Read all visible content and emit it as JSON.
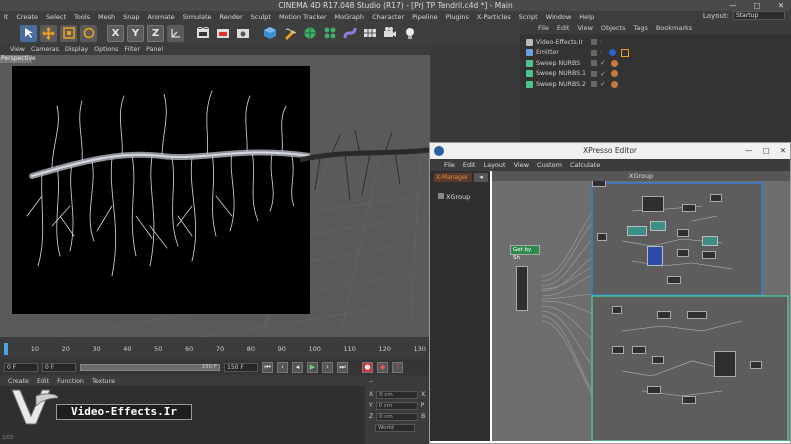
{
  "window": {
    "title": "CINEMA 4D R17.048 Studio (R17) - [Prj TP Tendril.c4d *] - Main",
    "controls": [
      "—",
      "□",
      "✕"
    ]
  },
  "menubar": {
    "items": [
      "lt",
      "Create",
      "Select",
      "Tools",
      "Mesh",
      "Snap",
      "Animate",
      "Simulate",
      "Render",
      "Sculpt",
      "Motion Tracker",
      "MoGraph",
      "Character",
      "Pipeline",
      "Plugins",
      "X-Particles",
      "Script",
      "Window",
      "Help"
    ],
    "layout_label": "Layout:",
    "layout_value": "Startup"
  },
  "toolbar": {
    "axis_x": "X",
    "axis_y": "Y",
    "axis_z": "Z"
  },
  "object_manager": {
    "menu": [
      "File",
      "Edit",
      "View",
      "Objects",
      "Tags",
      "Bookmarks"
    ],
    "objects": [
      {
        "name": "Video-Effects.Ir",
        "color": "#b9b9b9"
      },
      {
        "name": "Emitter",
        "color": "#6aa0e0"
      },
      {
        "name": "Sweep NURBS",
        "color": "#4cc48a"
      },
      {
        "name": "Sweep NURBS.1",
        "color": "#4cc48a"
      },
      {
        "name": "Sweep NURBS.2",
        "color": "#4cc48a"
      }
    ]
  },
  "viewport": {
    "menu": [
      "View",
      "Cameras",
      "Display",
      "Options",
      "Filter",
      "Panel"
    ],
    "label": "Perspective"
  },
  "timeline": {
    "ticks": [
      "0",
      "10",
      "20",
      "30",
      "40",
      "50",
      "60",
      "70",
      "80",
      "90",
      "100",
      "110",
      "120",
      "130"
    ],
    "current_frame": "0 F",
    "end_field": "150 F",
    "end_frame": "150 F"
  },
  "material_manager": {
    "menu": [
      "Create",
      "Edit",
      "Function",
      "Texture"
    ]
  },
  "coordinates": {
    "header": "--",
    "rows": [
      {
        "axis": "X",
        "value": "0 cm",
        "right": "X"
      },
      {
        "axis": "Y",
        "value": "0 cm",
        "right": "P"
      },
      {
        "axis": "Z",
        "value": "0 cm",
        "right": "B"
      }
    ],
    "mode": "World"
  },
  "logo": {
    "text": "Video-Effects.Ir",
    "letter": "V",
    "version": "2/03"
  },
  "xpresso": {
    "title": "XPresso Editor",
    "menu": [
      "File",
      "Edit",
      "Layout",
      "View",
      "Custom",
      "Calculate"
    ],
    "tab": "X-Manager",
    "tree_item": "XGroup",
    "group_title": "XGroup",
    "node_label": "Get by Sh"
  },
  "colors": {
    "accent_blue": "#3a7bd5",
    "accent_green": "#4cc48a",
    "panel": "#333333",
    "node_teal": "#3b8f88"
  }
}
